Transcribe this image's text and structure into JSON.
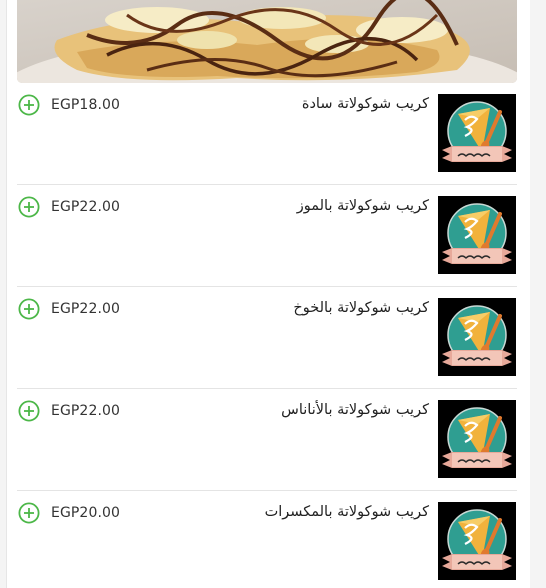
{
  "colors": {
    "accent_green": "#4cb748",
    "price_text": "#333333"
  },
  "hero": {
    "image": "chocolate-banana-crepe-photo"
  },
  "menu_items": [
    {
      "name": "كريب شوكولاتة سادة",
      "price": "EGP18.00"
    },
    {
      "name": "كريب شوكولاتة بالموز",
      "price": "EGP22.00"
    },
    {
      "name": "كريب شوكولاتة بالخوخ",
      "price": "EGP22.00"
    },
    {
      "name": "كريب شوكولاتة بالأناناس",
      "price": "EGP22.00"
    },
    {
      "name": "كريب شوكولاتة بالمكسرات",
      "price": "EGP20.00"
    }
  ],
  "icons": {
    "add": "plus-circle-icon",
    "thumb": "crepe-logo-icon"
  }
}
